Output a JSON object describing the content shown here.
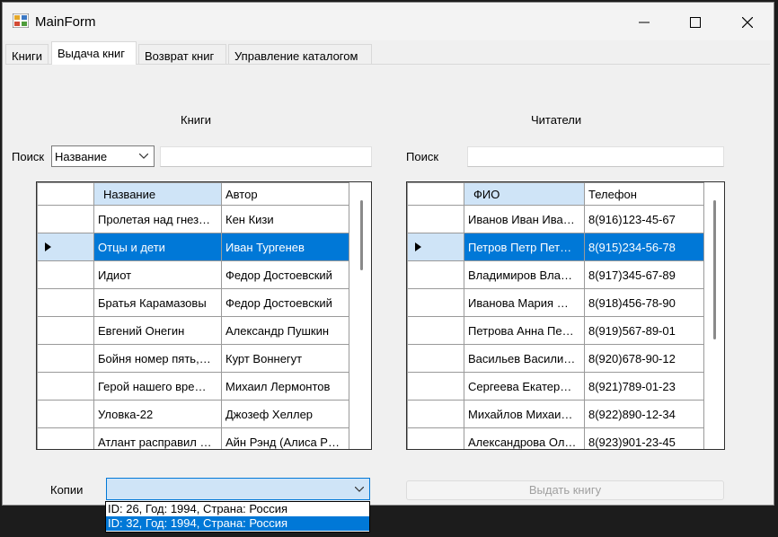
{
  "window": {
    "title": "MainForm"
  },
  "tabs": [
    {
      "label": "Книги"
    },
    {
      "label": "Выдача книг"
    },
    {
      "label": "Возврат книг"
    },
    {
      "label": "Управление каталогом"
    }
  ],
  "books": {
    "section_label": "Книги",
    "search_label": "Поиск",
    "search_field_value": "Название",
    "search_text": "",
    "columns": [
      "Название",
      "Автор"
    ],
    "rows": [
      [
        "Пролетая над гнез…",
        "Кен Кизи"
      ],
      [
        "Отцы и дети",
        "Иван Тургенев"
      ],
      [
        "Идиот",
        "Федор Достоевский"
      ],
      [
        "Братья Карамазовы",
        "Федор Достоевский"
      ],
      [
        "Евгений Онегин",
        "Александр Пушкин"
      ],
      [
        "Бойня номер пять,…",
        "Курт Воннегут"
      ],
      [
        "Герой нашего вре…",
        "Михаил Лермонтов"
      ],
      [
        "Уловка-22",
        "Джозеф Хеллер"
      ],
      [
        "Атлант расправил …",
        "Айн Рэнд (Алиса Р…"
      ]
    ],
    "selected_row": 1
  },
  "readers": {
    "section_label": "Читатели",
    "search_label": "Поиск",
    "search_text": "",
    "columns": [
      "ФИО",
      "Телефон"
    ],
    "rows": [
      [
        "Иванов Иван Ива…",
        "8(916)123-45-67"
      ],
      [
        "Петров Петр Пет…",
        "8(915)234-56-78"
      ],
      [
        "Владимиров Вла…",
        "8(917)345-67-89"
      ],
      [
        "Иванова Мария …",
        "8(918)456-78-90"
      ],
      [
        "Петрова Анна Пе…",
        "8(919)567-89-01"
      ],
      [
        "Васильев Васили…",
        "8(920)678-90-12"
      ],
      [
        "Сергеева Екатер…",
        "8(921)789-01-23"
      ],
      [
        "Михайлов Михаи…",
        "8(922)890-12-34"
      ],
      [
        "Александрова Ол…",
        "8(923)901-23-45"
      ]
    ],
    "selected_row": 1
  },
  "copies": {
    "label": "Копии",
    "value": "",
    "options": [
      "ID: 26, Год: 1994, Страна: Россия",
      "ID: 32, Год: 1994, Страна: Россия"
    ],
    "highlighted": 1
  },
  "issue_button": {
    "label": "Выдать книгу",
    "enabled": false
  },
  "colors": {
    "selection": "#0078d7",
    "header_selected": "#cfe4f7"
  }
}
